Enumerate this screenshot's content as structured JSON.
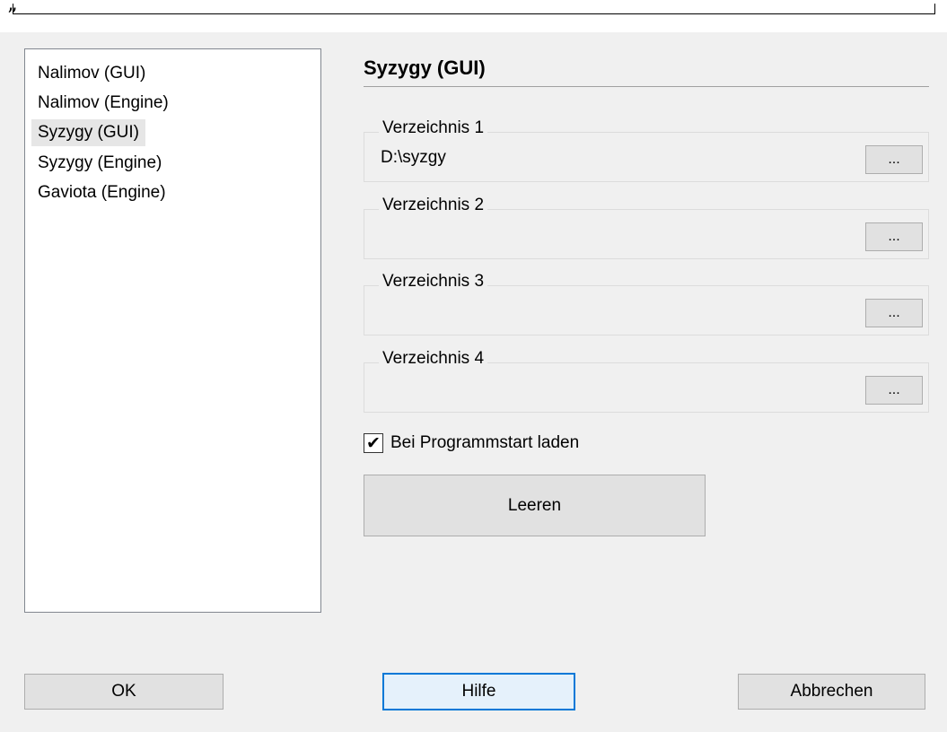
{
  "topbar": {
    "quote_glyph": "”"
  },
  "list": {
    "items": [
      {
        "label": "Nalimov (GUI)"
      },
      {
        "label": "Nalimov (Engine)"
      },
      {
        "label": "Syzygy (GUI)",
        "selected": true
      },
      {
        "label": "Syzygy (Engine)"
      },
      {
        "label": "Gaviota (Engine)"
      }
    ]
  },
  "section": {
    "title": "Syzygy (GUI)"
  },
  "groups": [
    {
      "label": "Verzeichnis 1",
      "value": "D:\\syzgy",
      "button_label": "..."
    },
    {
      "label": "Verzeichnis 2",
      "value": "",
      "button_label": "..."
    },
    {
      "label": "Verzeichnis 3",
      "value": "",
      "button_label": "..."
    },
    {
      "label": "Verzeichnis 4",
      "value": "",
      "button_label": "..."
    }
  ],
  "checkbox": {
    "label": "Bei Programmstart laden",
    "checked": true,
    "mark": "✔"
  },
  "buttons": {
    "clear": "Leeren",
    "ok": "OK",
    "help": "Hilfe",
    "cancel": "Abbrechen"
  },
  "colors": {
    "accent": "#0078d7",
    "dialog_bg": "#f0f0f0",
    "selection_bg": "#e6e6e6"
  }
}
